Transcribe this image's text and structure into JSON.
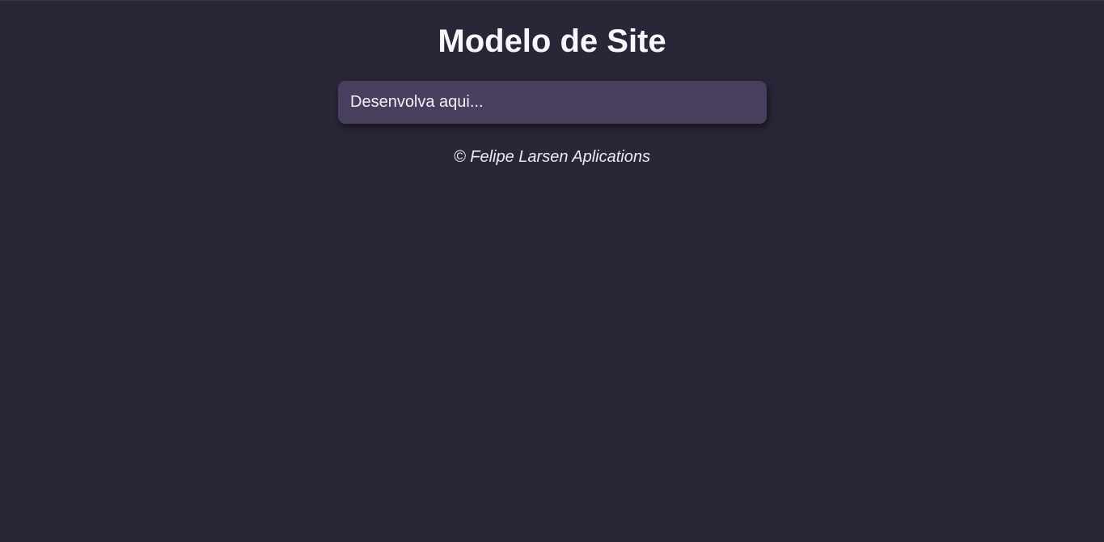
{
  "header": {
    "title": "Modelo de Site"
  },
  "main": {
    "content_text": "Desenvolva aqui..."
  },
  "footer": {
    "copyright": "© Felipe Larsen Aplications"
  },
  "colors": {
    "background": "#2a2637",
    "content_box": "#483f5e",
    "text": "#f2f0f7"
  }
}
